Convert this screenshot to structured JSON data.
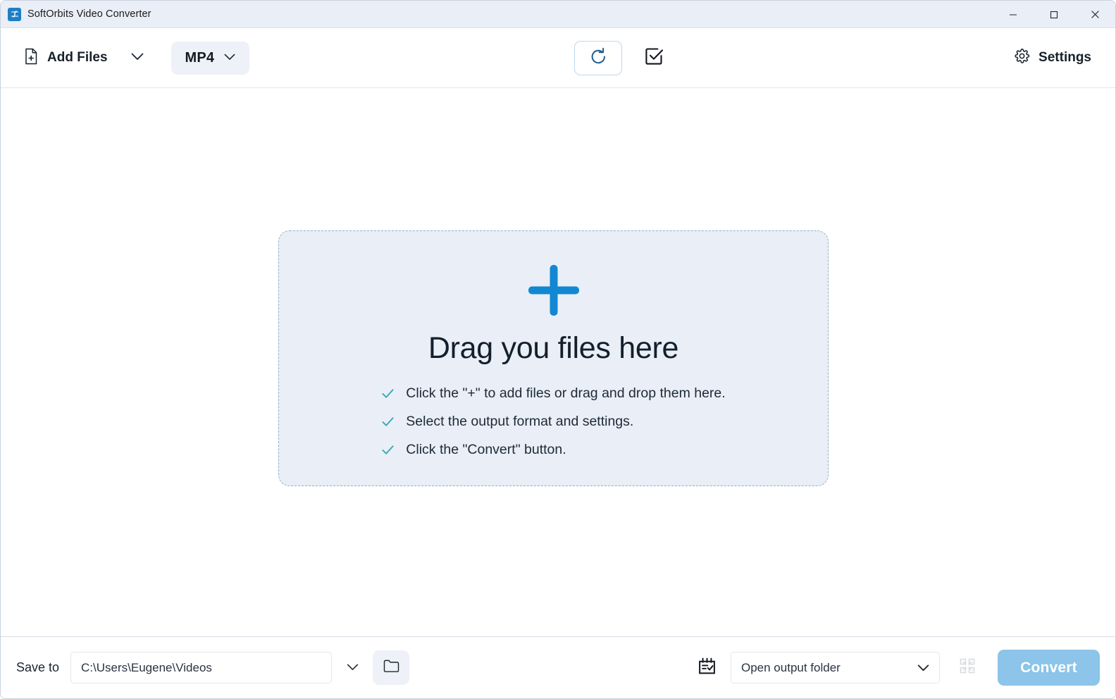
{
  "window": {
    "title": "SoftOrbits Video Converter",
    "app_icon": "video-converter-icon",
    "controls": {
      "minimize": "minimize-icon",
      "maximize": "maximize-icon",
      "close": "close-icon"
    }
  },
  "toolbar": {
    "add_files_label": "Add Files",
    "add_files_icon": "file-plus-icon",
    "add_files_chevron": "chevron-down-icon",
    "format_label": "MP4",
    "format_chevron": "chevron-down-icon",
    "rotate_icon": "rotate-clockwise-icon",
    "select_all_icon": "checkbox-checked-icon",
    "settings_label": "Settings",
    "settings_icon": "gear-icon"
  },
  "dropzone": {
    "plus_icon": "plus-icon",
    "title": "Drag you files here",
    "items": [
      {
        "check_icon": "check-icon",
        "text": "Click the \"+\" to add files or drag and drop them here."
      },
      {
        "check_icon": "check-icon",
        "text": "Select the output format and settings."
      },
      {
        "check_icon": "check-icon",
        "text": "Click the \"Convert\" button."
      }
    ]
  },
  "bottom_bar": {
    "save_to_label": "Save to",
    "save_to_path": "C:\\Users\\Eugene\\Videos",
    "save_to_placeholder": "C:\\Users\\Eugene\\Videos",
    "path_chevron": "chevron-down-icon",
    "browse_icon": "folder-icon",
    "schedule_icon": "calendar-check-icon",
    "after_convert_value": "Open output folder",
    "after_convert_chevron": "chevron-down-icon",
    "merge_icon": "merge-icon",
    "convert_label": "Convert"
  },
  "colors": {
    "titlebar_bg": "#e9eef7",
    "accent_blue": "#1287d2",
    "rotate_blue": "#1e5b8a",
    "check_teal": "#3aa8b8",
    "convert_bg": "#8cc4ea",
    "dropzone_bg": "#eaeef7",
    "dropzone_border": "#8fb3c4",
    "chip_bg": "#eef1f7"
  }
}
